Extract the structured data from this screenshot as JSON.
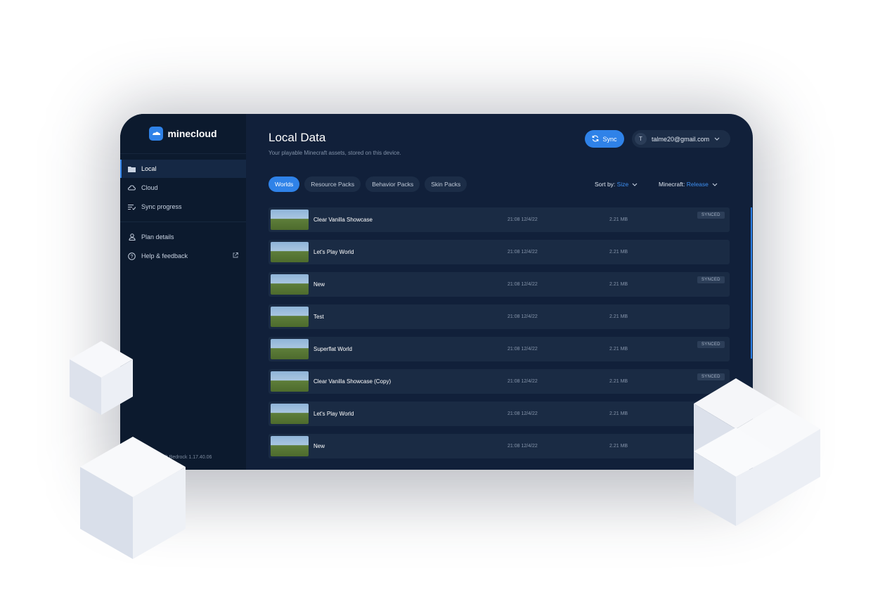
{
  "brand": {
    "name": "minecloud"
  },
  "sidebar": {
    "items": [
      {
        "label": "Local",
        "icon": "folder-icon",
        "active": true
      },
      {
        "label": "Cloud",
        "icon": "cloud-icon"
      },
      {
        "label": "Sync progress",
        "icon": "sync-progress-icon"
      }
    ],
    "secondary": [
      {
        "label": "Plan details",
        "icon": "user-icon"
      },
      {
        "label": "Help & feedback",
        "icon": "help-icon"
      }
    ],
    "version": "aft Bedrock 1.17.40.06"
  },
  "header": {
    "title": "Local Data",
    "subtitle": "Your playable Minecraft assets, stored on this device.",
    "sync_label": "Sync",
    "account": {
      "initial": "T",
      "email": "talme20@gmail.com"
    }
  },
  "tabs": [
    {
      "label": "Worlds",
      "active": true
    },
    {
      "label": "Resource Packs"
    },
    {
      "label": "Behavior Packs"
    },
    {
      "label": "Skin Packs"
    }
  ],
  "filters": {
    "sort_label": "Sort by:",
    "sort_value": "Size",
    "mc_label": "Minecraft:",
    "mc_value": "Release"
  },
  "worlds": [
    {
      "name": "Clear Vanilla Showcase",
      "time": "21:08 12/4/22",
      "size": "2.21 MB",
      "badge": "SYNCED"
    },
    {
      "name": "Let's Play World",
      "time": "21:08 12/4/22",
      "size": "2.21 MB",
      "badge": ""
    },
    {
      "name": "New",
      "time": "21:08 12/4/22",
      "size": "2.21 MB",
      "badge": "SYNCED"
    },
    {
      "name": "Test",
      "time": "21:08 12/4/22",
      "size": "2.21 MB",
      "badge": ""
    },
    {
      "name": "Superflat World",
      "time": "21:08 12/4/22",
      "size": "2.21 MB",
      "badge": "SYNCED"
    },
    {
      "name": "Clear Vanilla Showcase (Copy)",
      "time": "21:08 12/4/22",
      "size": "2.21 MB",
      "badge": "SYNCED"
    },
    {
      "name": "Let's Play World",
      "time": "21:08 12/4/22",
      "size": "2.21 MB",
      "badge": ""
    },
    {
      "name": "New",
      "time": "21:08 12/4/22",
      "size": "2.21 MB",
      "badge": ""
    }
  ],
  "colors": {
    "accent": "#2f82e8",
    "sidebar": "#0c1a2e",
    "main": "#11203a",
    "row": "#1a2b44"
  }
}
